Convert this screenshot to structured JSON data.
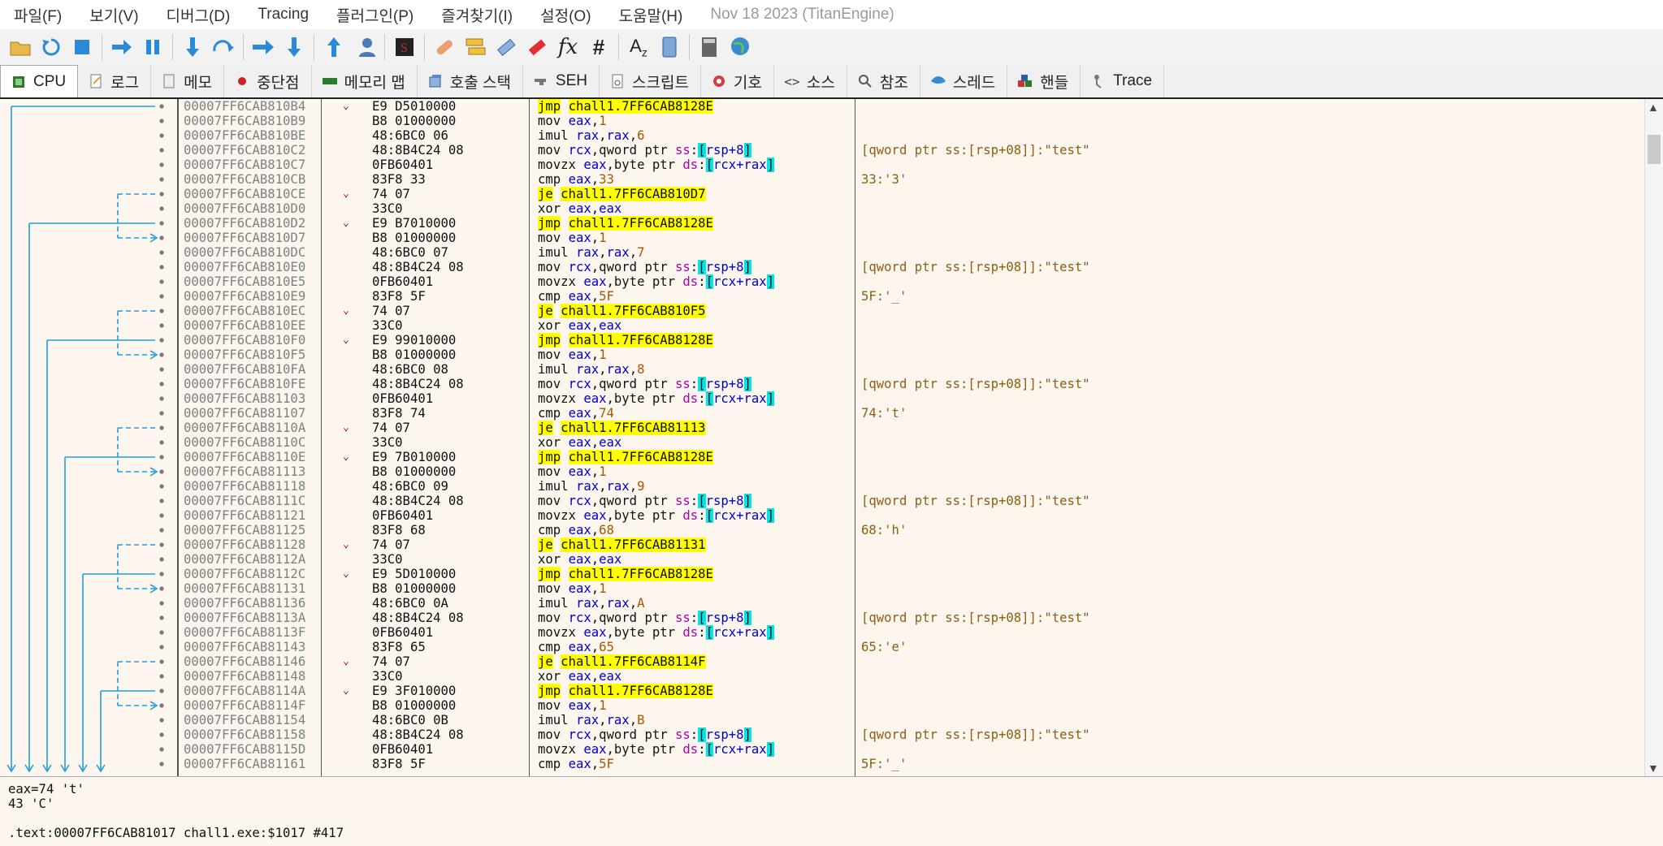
{
  "menu": [
    "파일(F)",
    "보기(V)",
    "디버그(D)",
    "Tracing",
    "플러그인(P)",
    "즐겨찾기(I)",
    "설정(O)",
    "도움말(H)"
  ],
  "build_date": "Nov 18 2023 (TitanEngine)",
  "toolbar_icons": [
    "open-icon",
    "restart-icon",
    "stop-icon",
    "run-icon",
    "pause-icon",
    "step-into-icon",
    "step-over-icon",
    "trace-into-icon",
    "trace-over-icon",
    "execute-till-return-icon",
    "run-to-user-code-icon",
    "scylla-icon",
    "patch-icon",
    "comment-icon",
    "label-icon",
    "bookmark-icon",
    "function-icon",
    "hash-icon",
    "font-icon",
    "device-icon",
    "calculator-icon",
    "globe-icon"
  ],
  "tabs": [
    {
      "label": "CPU",
      "icon": "cpu-icon"
    },
    {
      "label": "로그",
      "icon": "log-icon"
    },
    {
      "label": "메모",
      "icon": "notes-icon"
    },
    {
      "label": "중단점",
      "icon": "breakpoint-icon"
    },
    {
      "label": "메모리 맵",
      "icon": "memory-map-icon"
    },
    {
      "label": "호출 스택",
      "icon": "call-stack-icon"
    },
    {
      "label": "SEH",
      "icon": "seh-icon"
    },
    {
      "label": "스크립트",
      "icon": "script-icon"
    },
    {
      "label": "기호",
      "icon": "symbols-icon"
    },
    {
      "label": "소스",
      "icon": "source-icon"
    },
    {
      "label": "참조",
      "icon": "references-icon"
    },
    {
      "label": "스레드",
      "icon": "threads-icon"
    },
    {
      "label": "핸들",
      "icon": "handles-icon"
    },
    {
      "label": "Trace",
      "icon": "trace-icon"
    }
  ],
  "colors": {
    "background": "#fdf6ee",
    "jump_highlight": "#ffff00",
    "bracket_highlight": "#00e5e5",
    "arrow": "#1e9ee0"
  },
  "rows": [
    {
      "addr": "00007FF6CAB810B4",
      "bytes": "E9 D5010000",
      "mnem": "jmp",
      "ops": "chall1.7FF6CAB8128E",
      "jump": true,
      "mark": true,
      "comment": ""
    },
    {
      "addr": "00007FF6CAB810B9",
      "bytes": "B8 01000000",
      "mnem": "mov",
      "ops": "eax,1",
      "comment": ""
    },
    {
      "addr": "00007FF6CAB810BE",
      "bytes": "48:6BC0 06",
      "mnem": "imul",
      "ops": "rax,rax,6",
      "comment": ""
    },
    {
      "addr": "00007FF6CAB810C2",
      "bytes": "48:8B4C24 08",
      "mnem": "mov",
      "ops": "rcx,qword ptr ss:[rsp+8]",
      "comment": "[qword ptr ss:[rsp+08]]:\"test\""
    },
    {
      "addr": "00007FF6CAB810C7",
      "bytes": "0FB60401",
      "mnem": "movzx",
      "ops": "eax,byte ptr ds:[rcx+rax]",
      "comment": ""
    },
    {
      "addr": "00007FF6CAB810CB",
      "bytes": "83F8 33",
      "mnem": "cmp",
      "ops": "eax,33",
      "comment": "33:'3'"
    },
    {
      "addr": "00007FF6CAB810CE",
      "bytes": "74 07",
      "mnem": "je",
      "ops": "chall1.7FF6CAB810D7",
      "jump": true,
      "mark": true,
      "comment": ""
    },
    {
      "addr": "00007FF6CAB810D0",
      "bytes": "33C0",
      "mnem": "xor",
      "ops": "eax,eax",
      "comment": ""
    },
    {
      "addr": "00007FF6CAB810D2",
      "bytes": "E9 B7010000",
      "mnem": "jmp",
      "ops": "chall1.7FF6CAB8128E",
      "jump": true,
      "mark": true,
      "comment": ""
    },
    {
      "addr": "00007FF6CAB810D7",
      "bytes": "B8 01000000",
      "mnem": "mov",
      "ops": "eax,1",
      "comment": ""
    },
    {
      "addr": "00007FF6CAB810DC",
      "bytes": "48:6BC0 07",
      "mnem": "imul",
      "ops": "rax,rax,7",
      "comment": ""
    },
    {
      "addr": "00007FF6CAB810E0",
      "bytes": "48:8B4C24 08",
      "mnem": "mov",
      "ops": "rcx,qword ptr ss:[rsp+8]",
      "comment": "[qword ptr ss:[rsp+08]]:\"test\""
    },
    {
      "addr": "00007FF6CAB810E5",
      "bytes": "0FB60401",
      "mnem": "movzx",
      "ops": "eax,byte ptr ds:[rcx+rax]",
      "comment": ""
    },
    {
      "addr": "00007FF6CAB810E9",
      "bytes": "83F8 5F",
      "mnem": "cmp",
      "ops": "eax,5F",
      "comment": "5F:'_'"
    },
    {
      "addr": "00007FF6CAB810EC",
      "bytes": "74 07",
      "mnem": "je",
      "ops": "chall1.7FF6CAB810F5",
      "jump": true,
      "mark": true,
      "comment": ""
    },
    {
      "addr": "00007FF6CAB810EE",
      "bytes": "33C0",
      "mnem": "xor",
      "ops": "eax,eax",
      "comment": ""
    },
    {
      "addr": "00007FF6CAB810F0",
      "bytes": "E9 99010000",
      "mnem": "jmp",
      "ops": "chall1.7FF6CAB8128E",
      "jump": true,
      "mark": true,
      "comment": ""
    },
    {
      "addr": "00007FF6CAB810F5",
      "bytes": "B8 01000000",
      "mnem": "mov",
      "ops": "eax,1",
      "comment": ""
    },
    {
      "addr": "00007FF6CAB810FA",
      "bytes": "48:6BC0 08",
      "mnem": "imul",
      "ops": "rax,rax,8",
      "comment": ""
    },
    {
      "addr": "00007FF6CAB810FE",
      "bytes": "48:8B4C24 08",
      "mnem": "mov",
      "ops": "rcx,qword ptr ss:[rsp+8]",
      "comment": "[qword ptr ss:[rsp+08]]:\"test\""
    },
    {
      "addr": "00007FF6CAB81103",
      "bytes": "0FB60401",
      "mnem": "movzx",
      "ops": "eax,byte ptr ds:[rcx+rax]",
      "comment": ""
    },
    {
      "addr": "00007FF6CAB81107",
      "bytes": "83F8 74",
      "mnem": "cmp",
      "ops": "eax,74",
      "comment": "74:'t'"
    },
    {
      "addr": "00007FF6CAB8110A",
      "bytes": "74 07",
      "mnem": "je",
      "ops": "chall1.7FF6CAB81113",
      "jump": true,
      "mark": true,
      "comment": ""
    },
    {
      "addr": "00007FF6CAB8110C",
      "bytes": "33C0",
      "mnem": "xor",
      "ops": "eax,eax",
      "comment": ""
    },
    {
      "addr": "00007FF6CAB8110E",
      "bytes": "E9 7B010000",
      "mnem": "jmp",
      "ops": "chall1.7FF6CAB8128E",
      "jump": true,
      "mark": true,
      "comment": ""
    },
    {
      "addr": "00007FF6CAB81113",
      "bytes": "B8 01000000",
      "mnem": "mov",
      "ops": "eax,1",
      "comment": ""
    },
    {
      "addr": "00007FF6CAB81118",
      "bytes": "48:6BC0 09",
      "mnem": "imul",
      "ops": "rax,rax,9",
      "comment": ""
    },
    {
      "addr": "00007FF6CAB8111C",
      "bytes": "48:8B4C24 08",
      "mnem": "mov",
      "ops": "rcx,qword ptr ss:[rsp+8]",
      "comment": "[qword ptr ss:[rsp+08]]:\"test\""
    },
    {
      "addr": "00007FF6CAB81121",
      "bytes": "0FB60401",
      "mnem": "movzx",
      "ops": "eax,byte ptr ds:[rcx+rax]",
      "comment": ""
    },
    {
      "addr": "00007FF6CAB81125",
      "bytes": "83F8 68",
      "mnem": "cmp",
      "ops": "eax,68",
      "comment": "68:'h'"
    },
    {
      "addr": "00007FF6CAB81128",
      "bytes": "74 07",
      "mnem": "je",
      "ops": "chall1.7FF6CAB81131",
      "jump": true,
      "mark": true,
      "comment": ""
    },
    {
      "addr": "00007FF6CAB8112A",
      "bytes": "33C0",
      "mnem": "xor",
      "ops": "eax,eax",
      "comment": ""
    },
    {
      "addr": "00007FF6CAB8112C",
      "bytes": "E9 5D010000",
      "mnem": "jmp",
      "ops": "chall1.7FF6CAB8128E",
      "jump": true,
      "mark": true,
      "comment": ""
    },
    {
      "addr": "00007FF6CAB81131",
      "bytes": "B8 01000000",
      "mnem": "mov",
      "ops": "eax,1",
      "comment": ""
    },
    {
      "addr": "00007FF6CAB81136",
      "bytes": "48:6BC0 0A",
      "mnem": "imul",
      "ops": "rax,rax,A",
      "comment": ""
    },
    {
      "addr": "00007FF6CAB8113A",
      "bytes": "48:8B4C24 08",
      "mnem": "mov",
      "ops": "rcx,qword ptr ss:[rsp+8]",
      "comment": "[qword ptr ss:[rsp+08]]:\"test\""
    },
    {
      "addr": "00007FF6CAB8113F",
      "bytes": "0FB60401",
      "mnem": "movzx",
      "ops": "eax,byte ptr ds:[rcx+rax]",
      "comment": ""
    },
    {
      "addr": "00007FF6CAB81143",
      "bytes": "83F8 65",
      "mnem": "cmp",
      "ops": "eax,65",
      "comment": "65:'e'"
    },
    {
      "addr": "00007FF6CAB81146",
      "bytes": "74 07",
      "mnem": "je",
      "ops": "chall1.7FF6CAB8114F",
      "jump": true,
      "mark": true,
      "comment": ""
    },
    {
      "addr": "00007FF6CAB81148",
      "bytes": "33C0",
      "mnem": "xor",
      "ops": "eax,eax",
      "comment": ""
    },
    {
      "addr": "00007FF6CAB8114A",
      "bytes": "E9 3F010000",
      "mnem": "jmp",
      "ops": "chall1.7FF6CAB8128E",
      "jump": true,
      "mark": true,
      "comment": ""
    },
    {
      "addr": "00007FF6CAB8114F",
      "bytes": "B8 01000000",
      "mnem": "mov",
      "ops": "eax,1",
      "comment": ""
    },
    {
      "addr": "00007FF6CAB81154",
      "bytes": "48:6BC0 0B",
      "mnem": "imul",
      "ops": "rax,rax,B",
      "comment": ""
    },
    {
      "addr": "00007FF6CAB81158",
      "bytes": "48:8B4C24 08",
      "mnem": "mov",
      "ops": "rcx,qword ptr ss:[rsp+8]",
      "comment": "[qword ptr ss:[rsp+08]]:\"test\""
    },
    {
      "addr": "00007FF6CAB8115D",
      "bytes": "0FB60401",
      "mnem": "movzx",
      "ops": "eax,byte ptr ds:[rcx+rax]",
      "comment": ""
    },
    {
      "addr": "00007FF6CAB81161",
      "bytes": "83F8 5F",
      "mnem": "cmp",
      "ops": "eax,5F",
      "comment": "5F:'_'"
    }
  ],
  "info_lines": [
    "eax=74 't'",
    "43 'C'",
    "",
    ".text:00007FF6CAB81017 chall1.exe:$1017 #417"
  ]
}
